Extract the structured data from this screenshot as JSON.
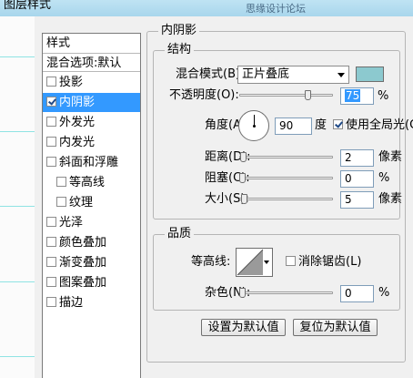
{
  "window": {
    "title": "图层样式",
    "watermark": "思缘设计论坛 www.MISSYUAN.COM"
  },
  "style_list": {
    "header": "样式",
    "blend_options": "混合选项:默认",
    "items": [
      {
        "label": "投影",
        "checked": false,
        "selected": false,
        "indent": false
      },
      {
        "label": "内阴影",
        "checked": true,
        "selected": true,
        "indent": false
      },
      {
        "label": "外发光",
        "checked": false,
        "selected": false,
        "indent": false
      },
      {
        "label": "内发光",
        "checked": false,
        "selected": false,
        "indent": false
      },
      {
        "label": "斜面和浮雕",
        "checked": false,
        "selected": false,
        "indent": false
      },
      {
        "label": "等高线",
        "checked": false,
        "selected": false,
        "indent": true
      },
      {
        "label": "纹理",
        "checked": false,
        "selected": false,
        "indent": true
      },
      {
        "label": "光泽",
        "checked": false,
        "selected": false,
        "indent": false
      },
      {
        "label": "颜色叠加",
        "checked": false,
        "selected": false,
        "indent": false
      },
      {
        "label": "渐变叠加",
        "checked": false,
        "selected": false,
        "indent": false
      },
      {
        "label": "图案叠加",
        "checked": false,
        "selected": false,
        "indent": false
      },
      {
        "label": "描边",
        "checked": false,
        "selected": false,
        "indent": false
      }
    ]
  },
  "inner_shadow": {
    "title": "内阴影",
    "structure": {
      "title": "结构",
      "blend_mode_label": "混合模式(B):",
      "blend_mode_value": "正片叠底",
      "shadow_color": "#8cc9cf",
      "opacity_label": "不透明度(O):",
      "opacity_value": "75",
      "opacity_fraction": 0.75,
      "unit_percent": "%",
      "angle_label": "角度(A):",
      "angle_value": "90",
      "angle_unit": "度",
      "use_global_light_label": "使用全局光(G)",
      "use_global_light_checked": true,
      "distance_label": "距离(D):",
      "distance_value": "2",
      "choke_label": "阻塞(C):",
      "choke_value": "0",
      "size_label": "大小(S):",
      "size_value": "5",
      "unit_pixels": "像素"
    },
    "quality": {
      "title": "品质",
      "contour_label": "等高线:",
      "antialias_label": "消除锯齿(L)",
      "antialias_checked": false,
      "noise_label": "杂色(N):",
      "noise_value": "0",
      "unit_percent": "%"
    },
    "buttons": {
      "make_default": "设置为默认值",
      "reset_default": "复位为默认值"
    }
  }
}
